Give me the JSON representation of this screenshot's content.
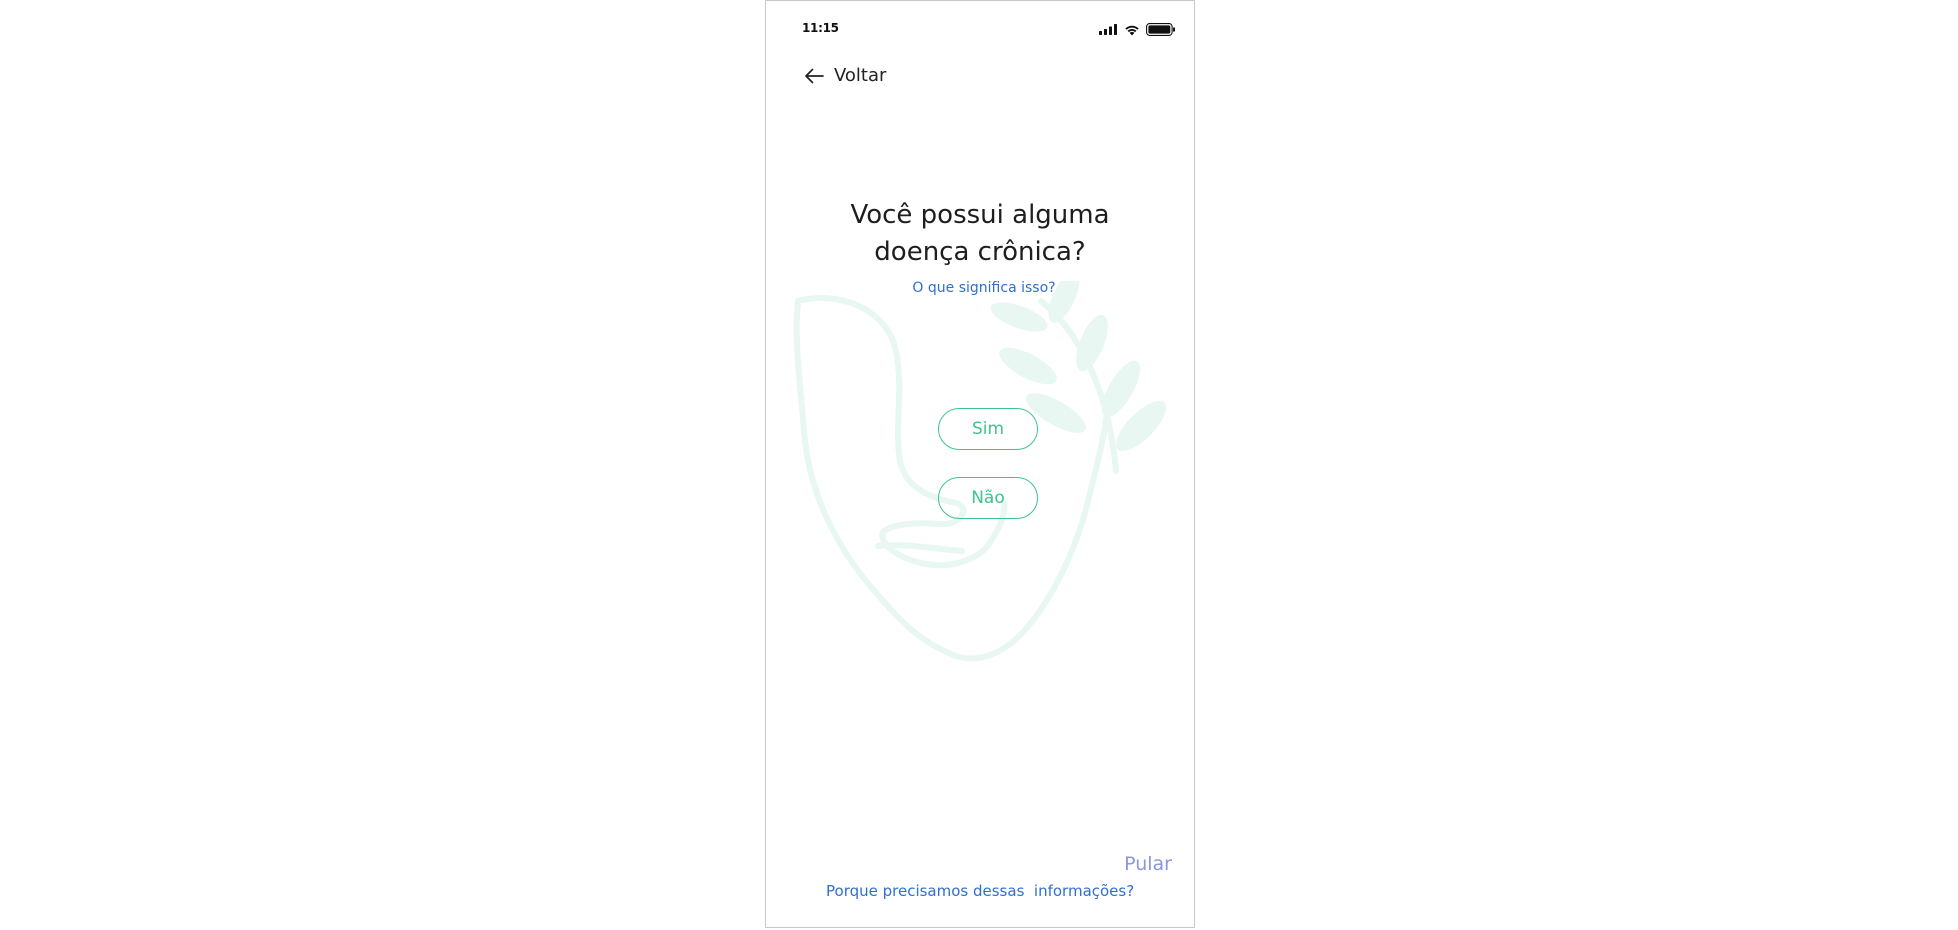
{
  "status_bar": {
    "time": "11:15",
    "icons": [
      "cellular-signal-icon",
      "wifi-icon",
      "battery-icon"
    ]
  },
  "nav": {
    "back_label": "Voltar",
    "back_icon": "arrow-left-icon"
  },
  "question": {
    "title": "Você possui alguma doença crônica?",
    "help_link": "O que significa isso?"
  },
  "options": {
    "yes_label": "Sim",
    "no_label": "Não"
  },
  "footer": {
    "skip_label": "Pular",
    "why_label": "Porque precisamos dessas  informações?"
  },
  "colors": {
    "accent_green": "#3fc48f",
    "link_blue": "#2f6fcf",
    "skip_purple": "#8a97df",
    "illustration_mint": "#e8f7f1"
  }
}
